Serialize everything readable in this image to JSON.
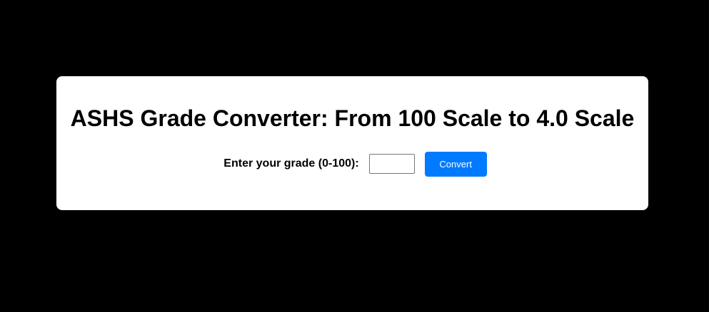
{
  "page": {
    "background_color": "#000000"
  },
  "card": {
    "background_color": "#ffffff",
    "title": "ASHS Grade Converter: From 100 Scale to 4.0 Scale",
    "form": {
      "grade_label": "Enter your grade (0-100):",
      "grade_input_value": "",
      "grade_input_placeholder": "",
      "convert_label": "Convert",
      "button_color": "#007bff"
    }
  }
}
